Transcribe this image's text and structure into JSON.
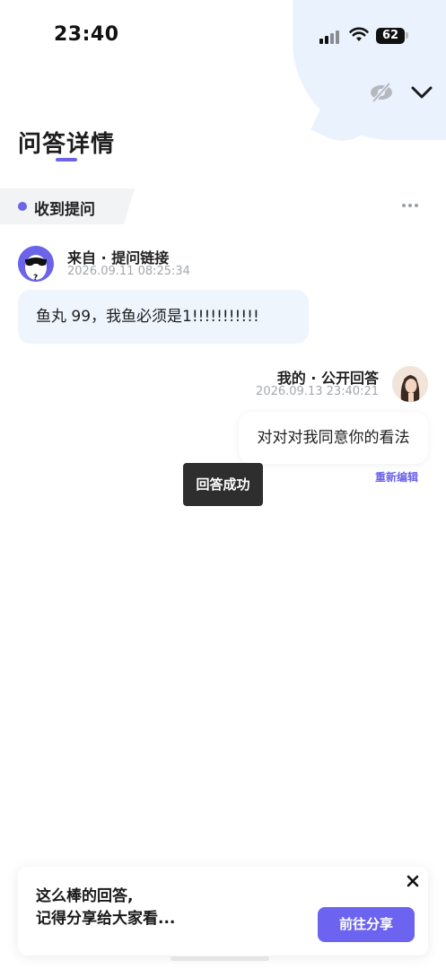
{
  "status_bar": {
    "time": "23:40",
    "battery": "62",
    "icons": [
      "signal-icon",
      "wifi-icon",
      "battery-icon"
    ]
  },
  "header": {
    "title": "问答详情",
    "actions": [
      "eye-off-icon",
      "chevron-down-icon"
    ]
  },
  "section": {
    "label": "收到提问",
    "more_icon": "more-horizontal-icon"
  },
  "incoming": {
    "sender": "来自 · 提问链接",
    "time": "2026.09.11 08:25:34",
    "message": "鱼丸 99，我鱼必须是1!!!!!!!!!!!"
  },
  "outgoing": {
    "sender": "我的 · 公开回答",
    "time": "2026.09.13 23:40:21",
    "message": "对对对我同意你的看法",
    "re_edit": "重新编辑"
  },
  "toast": {
    "text": "回答成功"
  },
  "share_card": {
    "line1": "这么棒的回答,",
    "line2": "记得分享给大家看...",
    "button": "前往分享",
    "close_icon": "close-icon"
  },
  "colors": {
    "accent": "#6b63e8",
    "bubble_bg": "#eef5fd",
    "toast_bg": "#2e2e2e",
    "meta_text": "#a3a8ae"
  }
}
